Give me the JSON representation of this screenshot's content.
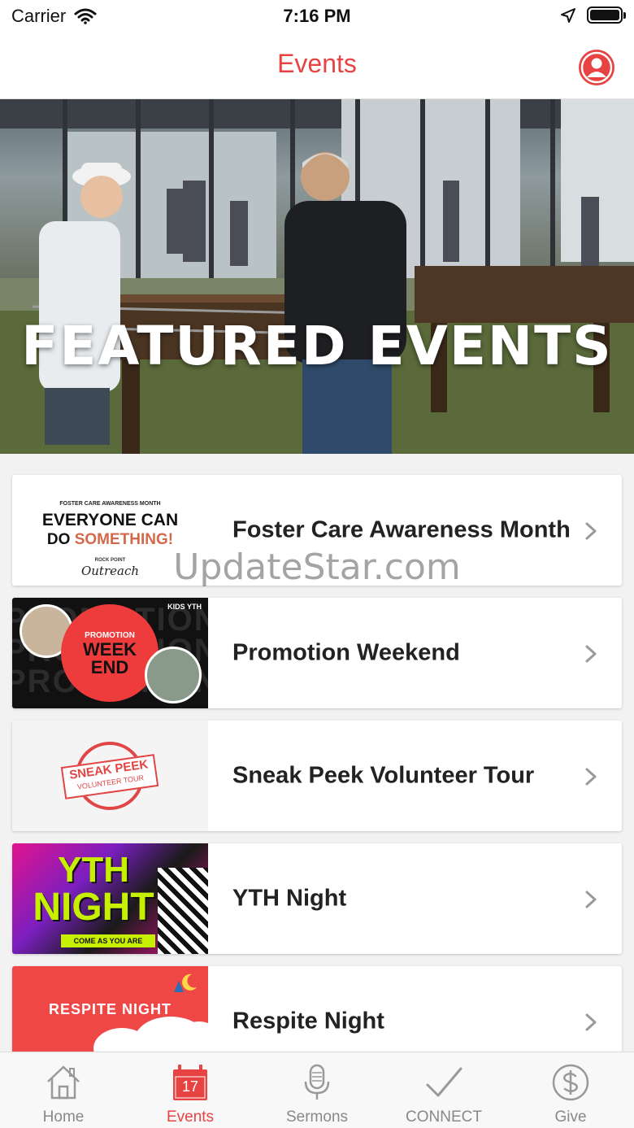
{
  "status_bar": {
    "carrier": "Carrier",
    "time": "7:16 PM"
  },
  "header": {
    "title": "Events"
  },
  "hero": {
    "title": "FEATURED EVENTS"
  },
  "events": [
    {
      "title": "Foster Care Awareness Month",
      "thumb": {
        "line1": "FOSTER CARE AWARENESS MONTH",
        "line2": "EVERYONE CAN",
        "line3a": "DO ",
        "line3b": "SOMETHING!",
        "line4": "ROCK POINT",
        "line5": "Outreach"
      }
    },
    {
      "title": "Promotion Weekend",
      "thumb": {
        "top_right": "KIDS  YTH",
        "small": "PROMOTION",
        "line1": "WEEK",
        "line2": "END"
      }
    },
    {
      "title": "Sneak Peek Volunteer Tour",
      "thumb": {
        "line1": "SNEAK PEEK",
        "line2": "VOLUNTEER TOUR"
      }
    },
    {
      "title": "YTH Night",
      "thumb": {
        "line1": "YTH",
        "line2": "NIGHT",
        "tag": "COME AS YOU ARE"
      }
    },
    {
      "title": "Respite Night",
      "thumb": {
        "line1": "RESPITE NIGHT"
      }
    }
  ],
  "watermark": "UpdateStar.com",
  "tabs": [
    {
      "label": "Home",
      "icon": "home-icon",
      "active": false
    },
    {
      "label": "Events",
      "icon": "calendar-icon",
      "active": true,
      "badge": "17"
    },
    {
      "label": "Sermons",
      "icon": "microphone-icon",
      "active": false
    },
    {
      "label": "CONNECT",
      "icon": "checkmark-icon",
      "active": false
    },
    {
      "label": "Give",
      "icon": "dollar-icon",
      "active": false
    }
  ],
  "colors": {
    "accent": "#e84343",
    "tab_inactive": "#888888"
  }
}
